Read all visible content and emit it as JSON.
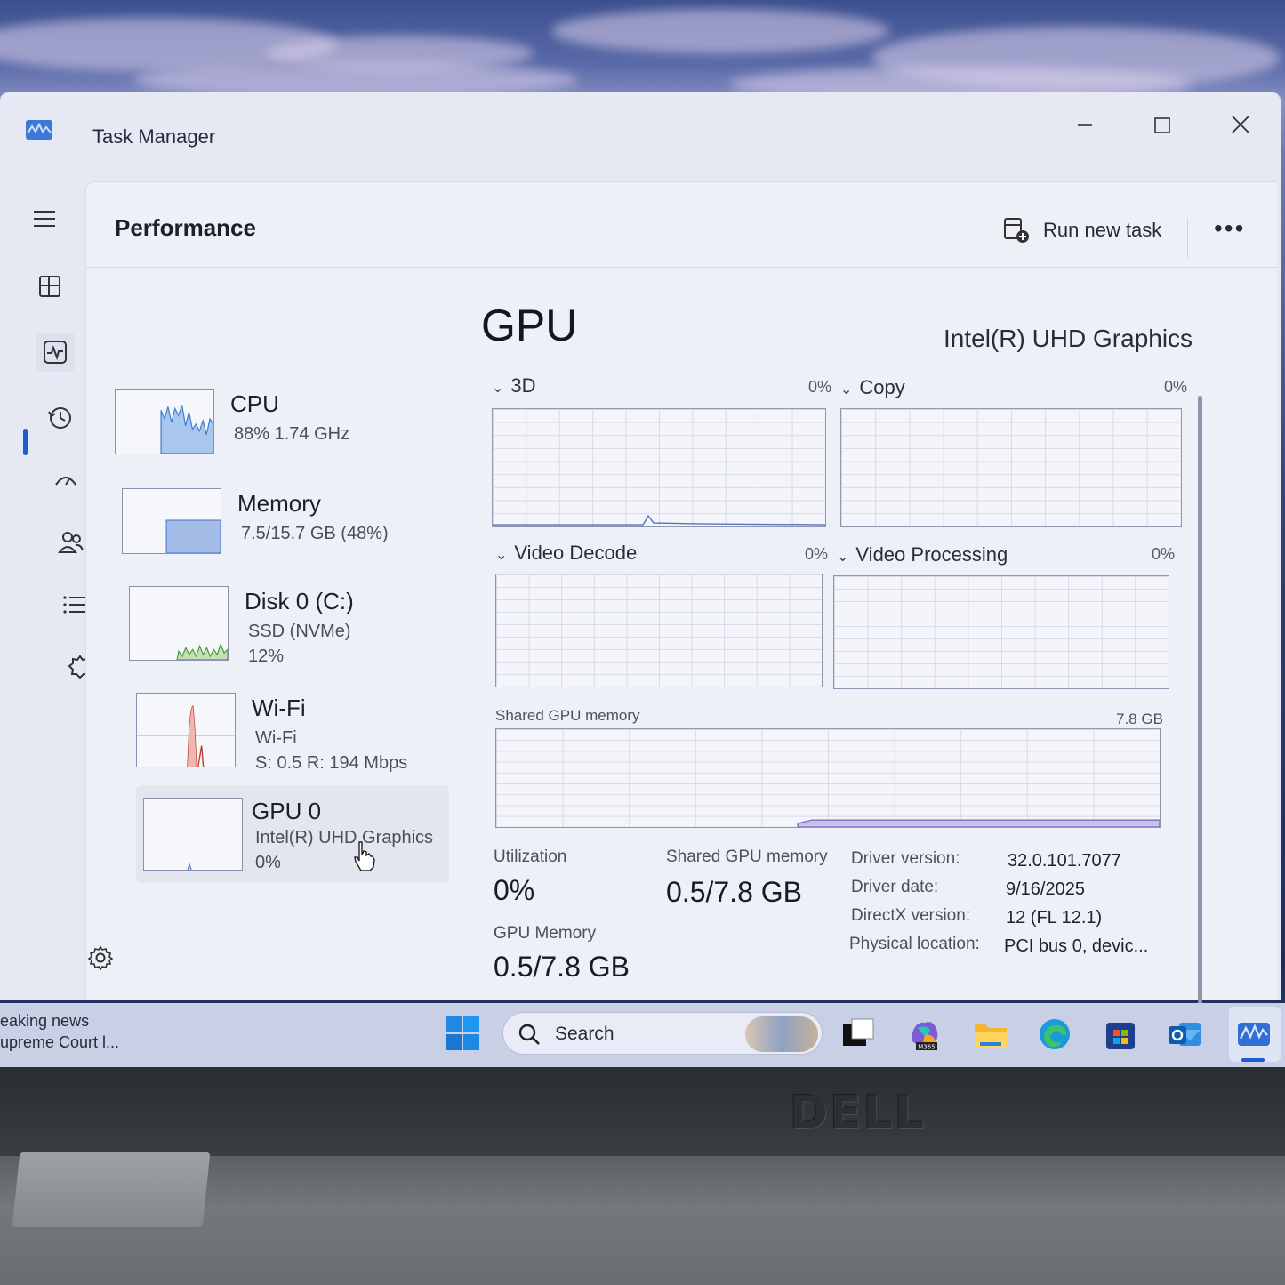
{
  "window": {
    "title": "Task Manager",
    "controls": {
      "minimize": "—",
      "maximize": "☐",
      "close": "✕"
    }
  },
  "nav": {
    "items": [
      "hamburger-icon",
      "processes-icon",
      "performance-icon",
      "app-history-icon",
      "startup-apps-icon",
      "users-icon",
      "details-icon",
      "services-icon"
    ],
    "active": "performance-icon",
    "settings": "gear-icon"
  },
  "header": {
    "title": "Performance",
    "run_new_task": "Run new task",
    "more": "•••"
  },
  "perf_list": [
    {
      "name": "CPU",
      "sub1": "88%  1.74 GHz",
      "sub2": "",
      "color": "#3a7bd5"
    },
    {
      "name": "Memory",
      "sub1": "7.5/15.7 GB (48%)",
      "sub2": "",
      "fill_fraction": 0.48,
      "color": "#5a7fd0"
    },
    {
      "name": "Disk 0 (C:)",
      "sub1": "SSD (NVMe)",
      "sub2": "12%",
      "color": "#4a9a3a"
    },
    {
      "name": "Wi-Fi",
      "sub1": "Wi-Fi",
      "sub2": "S: 0.5  R: 194 Mbps",
      "color": "#c0392b"
    },
    {
      "name": "GPU 0",
      "sub1": "Intel(R) UHD Graphics",
      "sub2": "0%",
      "color": "#4a6fc0"
    }
  ],
  "gpu": {
    "title": "GPU",
    "model": "Intel(R) UHD Graphics",
    "graphs": [
      {
        "label": "3D",
        "percent": "0%"
      },
      {
        "label": "Copy",
        "percent": "0%"
      },
      {
        "label": "Video Decode",
        "percent": "0%"
      },
      {
        "label": "Video Processing",
        "percent": "0%"
      }
    ],
    "shared_memory_graph": {
      "label": "Shared GPU memory",
      "max": "7.8 GB"
    },
    "stats": {
      "utilization_label": "Utilization",
      "utilization_value": "0%",
      "shared_label": "Shared GPU memory",
      "shared_value": "0.5/7.8 GB",
      "gpu_memory_label": "GPU Memory",
      "gpu_memory_value": "0.5/7.8 GB"
    },
    "info": [
      {
        "key": "Driver version:",
        "value": "32.0.101.7077"
      },
      {
        "key": "Driver date:",
        "value": "9/16/2025"
      },
      {
        "key": "DirectX version:",
        "value": "12 (FL 12.1)"
      },
      {
        "key": "Physical location:",
        "value": "PCI bus 0, devic..."
      }
    ]
  },
  "taskbar": {
    "news_line1": "eaking news",
    "news_line2": "upreme Court l...",
    "search_placeholder": "Search",
    "apps": [
      "start-icon",
      "task-view-icon",
      "m365-icon",
      "file-explorer-icon",
      "edge-icon",
      "store-icon",
      "outlook-icon",
      "task-manager-icon"
    ],
    "m365_label": "M365"
  },
  "bezel": {
    "brand": "DELL"
  },
  "colors": {
    "accent": "#1f5bd0",
    "window_bg": "#e6e9f4",
    "graph_line": "#8f96ad"
  }
}
